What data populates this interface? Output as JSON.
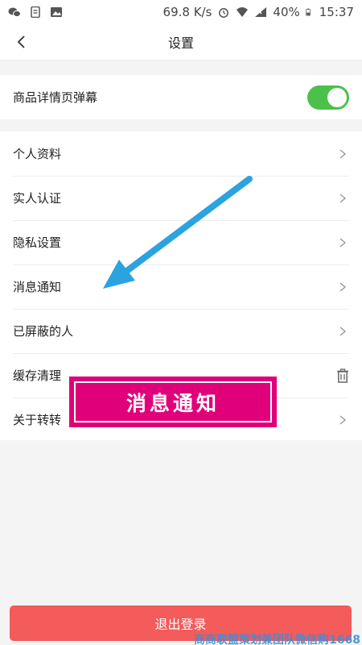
{
  "status_bar": {
    "speed": "69.8 K/s",
    "battery": "40%",
    "time": "15:37",
    "icons_left": [
      "wechat-icon",
      "document-icon",
      "image-icon"
    ],
    "icons_right": [
      "alarm-icon",
      "wifi-icon",
      "signal-icon",
      "battery-icon"
    ]
  },
  "nav": {
    "back_icon": "chevron-left-icon",
    "title": "设置"
  },
  "toggle_row": {
    "label": "商品详情页弹幕",
    "enabled": true,
    "accent": "#4bc14b"
  },
  "settings": {
    "items": [
      {
        "label": "个人资料",
        "icon": "chevron-right-icon"
      },
      {
        "label": "实人认证",
        "icon": "chevron-right-icon"
      },
      {
        "label": "隐私设置",
        "icon": "chevron-right-icon"
      },
      {
        "label": "消息通知",
        "icon": "chevron-right-icon"
      },
      {
        "label": "已屏蔽的人",
        "icon": "chevron-right-icon"
      },
      {
        "label": "缓存清理",
        "icon": "trash-icon"
      },
      {
        "label": "关于转转",
        "icon": "chevron-right-icon"
      }
    ]
  },
  "annotation": {
    "text": "消息通知",
    "color": "#e0007a",
    "arrow_color": "#2aa3e0"
  },
  "logout": {
    "label": "退出登录",
    "color": "#f45b5b"
  },
  "watermark": {
    "text": "商商联盟策划兼团队微信购1668"
  }
}
